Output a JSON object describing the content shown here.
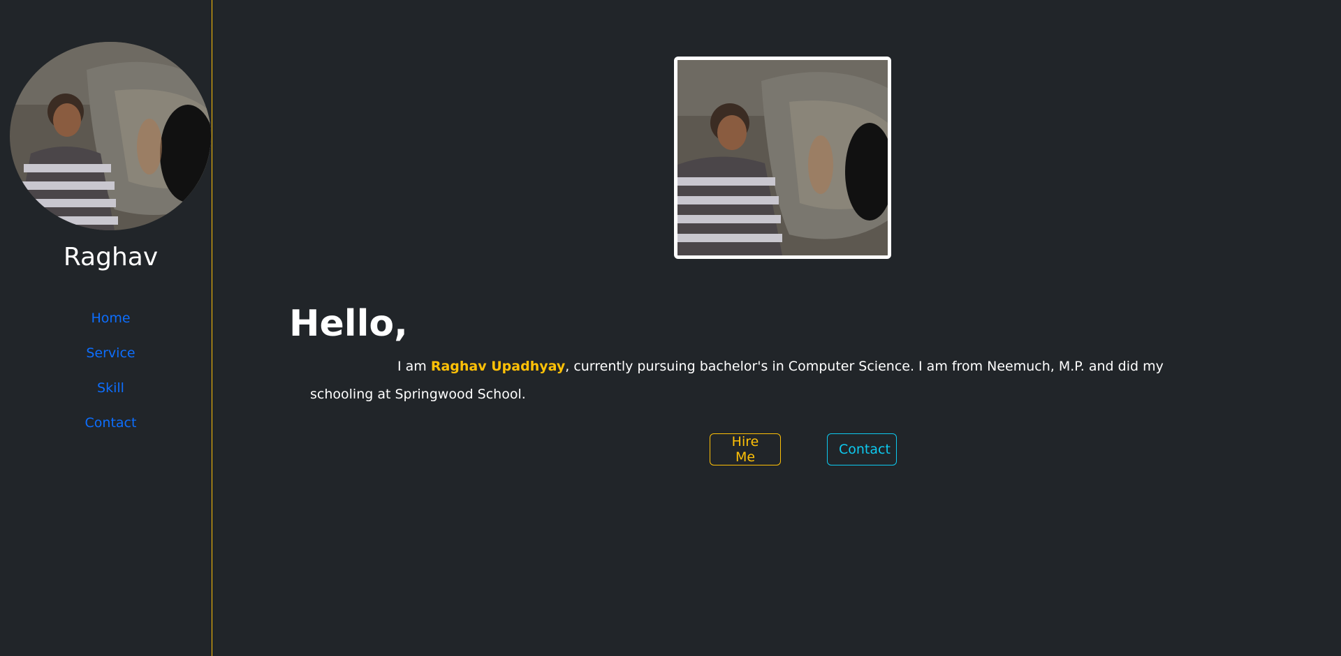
{
  "profile": {
    "name": "Raghav",
    "avatar_alt": "profile-photo"
  },
  "nav": {
    "items": [
      {
        "label": "Home"
      },
      {
        "label": "Service"
      },
      {
        "label": "Skill"
      },
      {
        "label": "Contact"
      }
    ]
  },
  "hero": {
    "greeting": "Hello,",
    "intro_prefix": "I am ",
    "full_name": "Raghav Upadhyay",
    "intro_suffix": ", currently pursuing bachelor's in Computer Science. I am from Neemuch, M.P. and did my schooling at Springwood School."
  },
  "buttons": {
    "hire_label": "Hire Me",
    "contact_label": "Contact"
  },
  "colors": {
    "background": "#212529",
    "accent_yellow": "#ffc107",
    "link_blue": "#0d6efd",
    "accent_cyan": "#0dcaf0"
  }
}
